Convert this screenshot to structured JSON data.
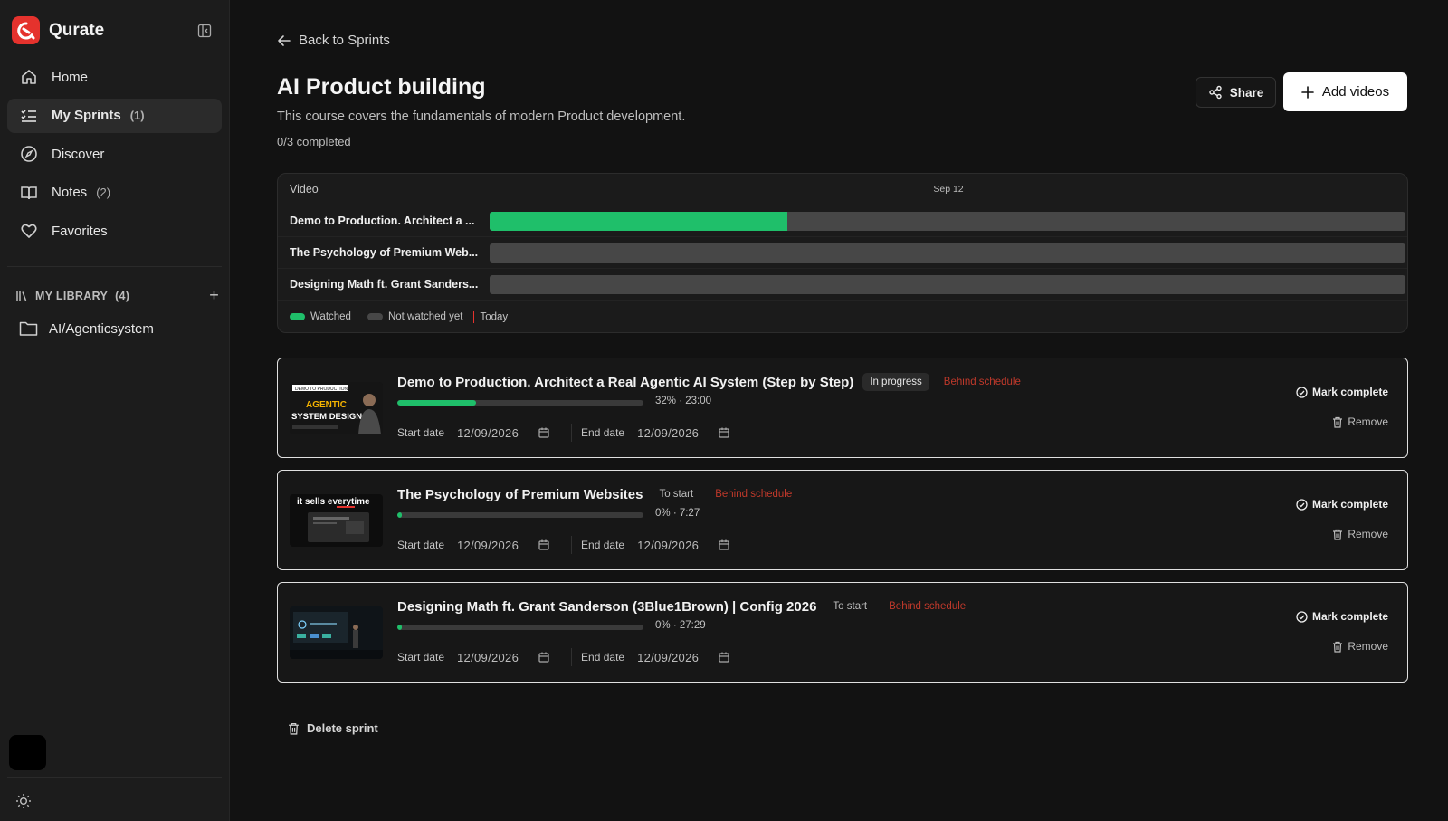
{
  "app": {
    "name": "Qurate",
    "accent": "#e5322d"
  },
  "sidebar": {
    "items": [
      {
        "label": "Home",
        "count": "",
        "icon": "home-icon"
      },
      {
        "label": "My Sprints",
        "count": "(1)",
        "icon": "list-check-icon"
      },
      {
        "label": "Discover",
        "count": "",
        "icon": "compass-icon"
      },
      {
        "label": "Notes",
        "count": "(2)",
        "icon": "book-icon"
      },
      {
        "label": "Favorites",
        "count": "",
        "icon": "heart-icon"
      }
    ],
    "library": {
      "label": "MY LIBRARY",
      "count": "(4)",
      "add": "+"
    },
    "library_items": [
      {
        "label": "AI/Agenticsystem",
        "icon": "folder-icon"
      }
    ]
  },
  "header": {
    "back_label": "Back to Sprints",
    "title": "AI Product building",
    "description": "This course covers the fundamentals of modern Product development.",
    "completed": "0/3 completed",
    "share_label": "Share",
    "add_videos_label": "Add videos"
  },
  "timeline": {
    "video_header": "Video",
    "date_header": "Sep 12",
    "rows": [
      {
        "name": "Demo to Production. Architect a ...",
        "watched": 0.325
      },
      {
        "name": "The Psychology of Premium Web...",
        "watched": 0
      },
      {
        "name": "Designing Math ft. Grant Sanders...",
        "watched": 0
      }
    ],
    "legend": {
      "watched": "Watched",
      "not_watched": "Not watched yet",
      "today": "Today"
    },
    "colors": {
      "watched": "#1fbf6a",
      "not_watched": "#474747",
      "today": "#e5322d"
    }
  },
  "videos": [
    {
      "title": "Demo to Production. Architect a Real Agentic AI System (Step by Step)",
      "status": "In progress",
      "schedule": "Behind schedule",
      "progress": 0.32,
      "progress_text": "32% · 23:00",
      "start_label": "Start date",
      "start_date": "12/09/2026",
      "end_label": "End date",
      "end_date": "12/09/2026",
      "mark_label": "Mark complete",
      "remove_label": "Remove",
      "thumb": {
        "top": "DEMO TO PRODUCTION",
        "line1": "AGENTIC",
        "line2": "SYSTEM DESIGN"
      }
    },
    {
      "title": "The Psychology of Premium Websites",
      "status": "To start",
      "schedule": "Behind schedule",
      "progress": 0.02,
      "progress_text": "0% · 7:27",
      "start_label": "Start date",
      "start_date": "12/09/2026",
      "end_label": "End date",
      "end_date": "12/09/2026",
      "mark_label": "Mark complete",
      "remove_label": "Remove",
      "thumb": {
        "caption": "it sells everytime"
      }
    },
    {
      "title": "Designing Math ft. Grant Sanderson (3Blue1Brown) | Config 2026",
      "status": "To start",
      "schedule": "Behind schedule",
      "progress": 0.02,
      "progress_text": "0% · 27:29",
      "start_label": "Start date",
      "start_date": "12/09/2026",
      "end_label": "End date",
      "end_date": "12/09/2026",
      "mark_label": "Mark complete",
      "remove_label": "Remove",
      "thumb": {}
    }
  ],
  "footer": {
    "delete_label": "Delete sprint"
  }
}
